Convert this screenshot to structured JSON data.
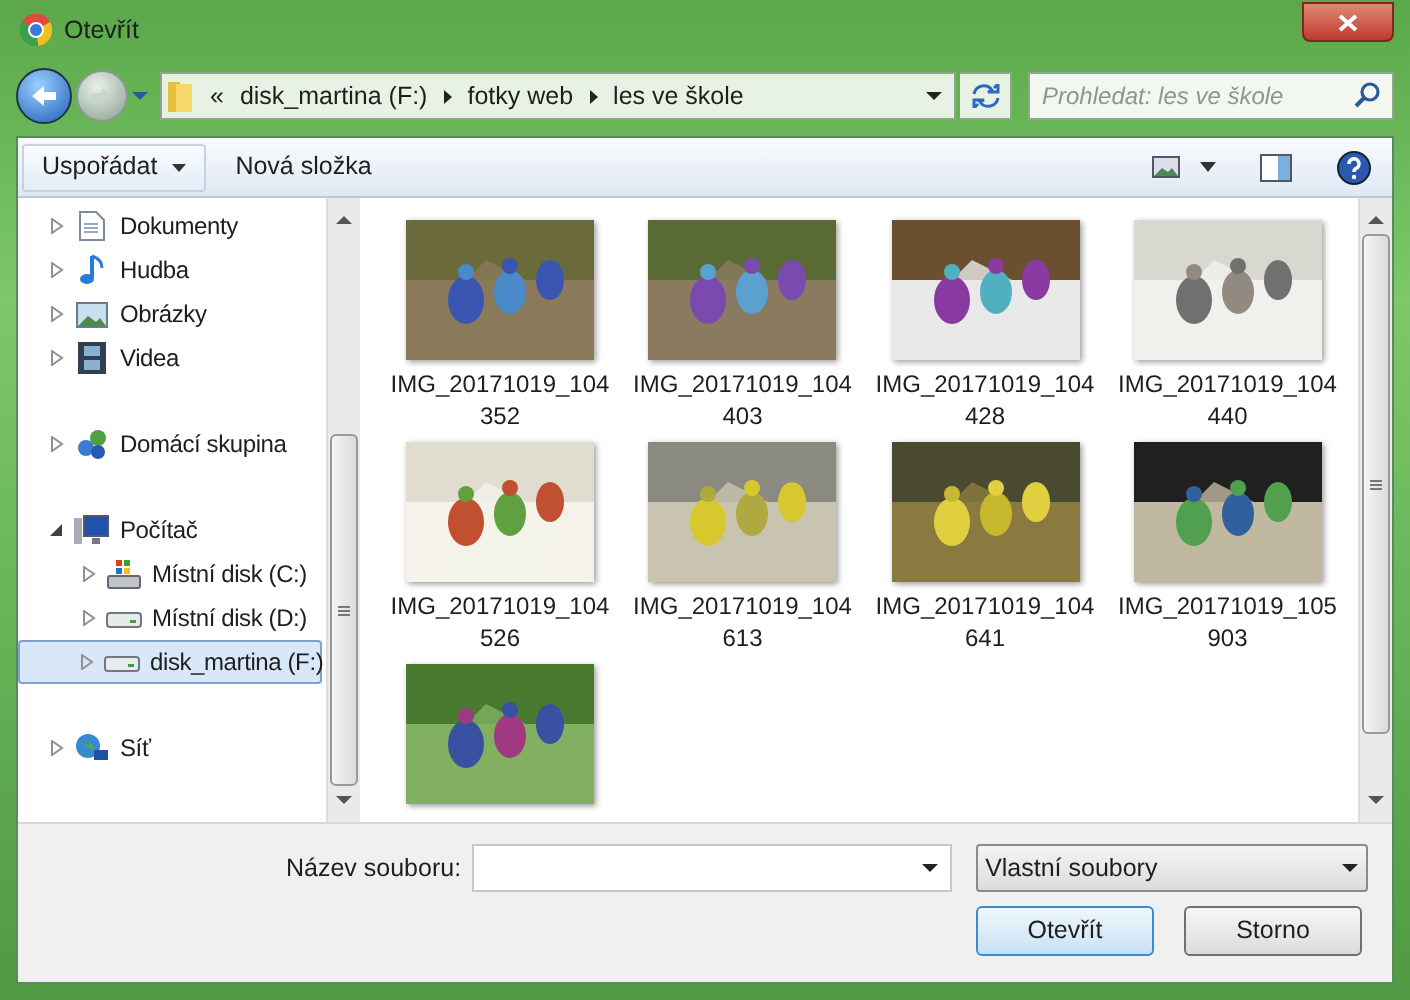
{
  "window": {
    "title": "Otevřít"
  },
  "address": {
    "crumbs": [
      "«",
      "disk_martina (F:)",
      "fotky web",
      "les ve škole"
    ]
  },
  "search": {
    "placeholder": "Prohledat: les ve škole"
  },
  "toolbar": {
    "organize": "Uspořádat",
    "new_folder": "Nová složka"
  },
  "sidebar": {
    "groups": [
      {
        "items": [
          {
            "label": "Dokumenty",
            "kind": "doc",
            "expanded": false,
            "selected": false
          },
          {
            "label": "Hudba",
            "kind": "music",
            "expanded": false,
            "selected": false
          },
          {
            "label": "Obrázky",
            "expanded": false,
            "selected": false
          },
          {
            "label": "Videa",
            "kind": "video",
            "expanded": false,
            "selected": false
          }
        ]
      },
      {
        "items": [
          {
            "label": "Domácí skupina",
            "kind": "group",
            "expanded": false,
            "selected": false
          }
        ]
      },
      {
        "items": [
          {
            "label": "Počítač",
            "kind": "computer",
            "expanded": true,
            "selected": false,
            "children": [
              {
                "label": "Místní disk (C:)",
                "kind": "sysdisk",
                "expanded": false,
                "selected": false
              },
              {
                "label": "Místní disk (D:)",
                "kind": "disk",
                "expanded": false,
                "selected": false
              },
              {
                "label": "disk_martina (F:)",
                "kind": "disk",
                "expanded": false,
                "selected": true
              }
            ]
          }
        ]
      },
      {
        "items": [
          {
            "label": "Síť",
            "kind": "network",
            "expanded": false,
            "selected": false
          }
        ]
      }
    ]
  },
  "files": [
    {
      "name": "IMG_20171019_104352",
      "kind": "picture"
    },
    {
      "name": "IMG_20171019_104403",
      "kind": "picture"
    },
    {
      "name": "IMG_20171019_104428",
      "kind": "picture"
    },
    {
      "name": "IMG_20171019_104440",
      "kind": "picture"
    },
    {
      "name": "IMG_20171019_104526",
      "kind": "picture"
    },
    {
      "name": "IMG_20171019_104613",
      "kind": "picture"
    },
    {
      "name": "IMG_20171019_104641",
      "kind": "picture"
    },
    {
      "name": "IMG_20171019_105903",
      "kind": "picture"
    },
    {
      "kind": "picture"
    }
  ],
  "footer": {
    "filename_label": "Název souboru:",
    "filter": "Vlastní soubory",
    "open": "Otevřít",
    "cancel": "Storno"
  }
}
